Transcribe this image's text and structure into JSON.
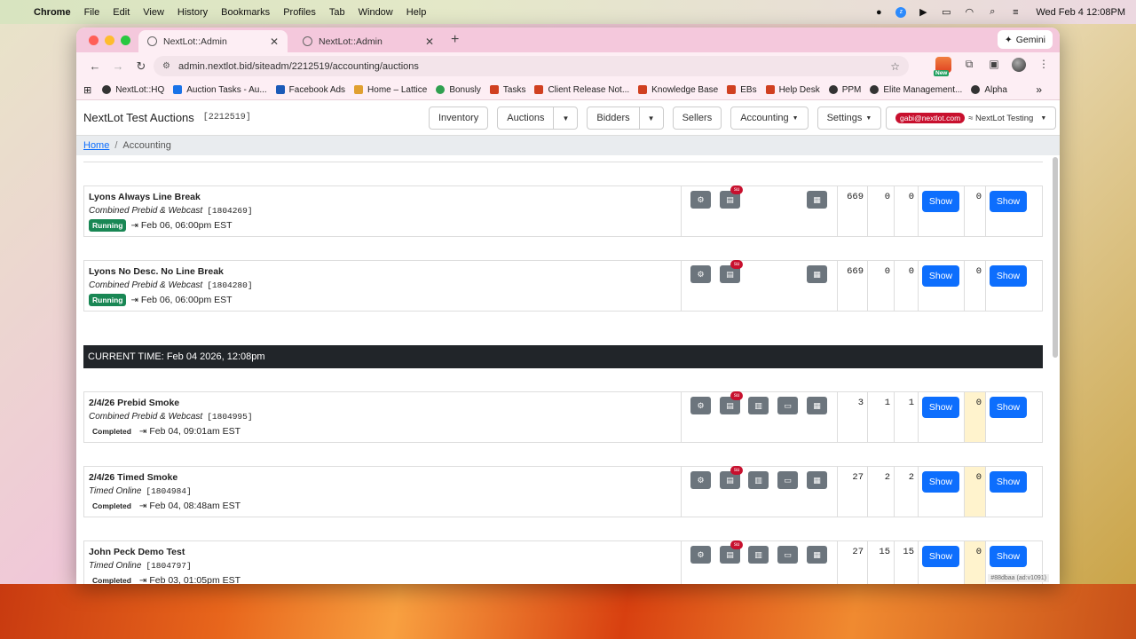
{
  "menubar": {
    "items": [
      "Chrome",
      "File",
      "Edit",
      "View",
      "History",
      "Bookmarks",
      "Profiles",
      "Tab",
      "Window",
      "Help"
    ],
    "clock": "Wed Feb 4  12:08PM"
  },
  "browser": {
    "tabs": [
      {
        "title": "NextLot::Admin"
      },
      {
        "title": "NextLot::Admin"
      }
    ],
    "gemini": "Gemini",
    "url": "admin.nextlot.bid/siteadm/2212519/accounting/auctions",
    "ext_new": "New",
    "bookmarks": [
      {
        "label": "NextLot::HQ",
        "color": "#333"
      },
      {
        "label": "Auction Tasks - Au...",
        "color": "#1a73e8"
      },
      {
        "label": "Facebook Ads",
        "color": "#1a5ab8"
      },
      {
        "label": "Home – Lattice",
        "color": "#e0a030"
      },
      {
        "label": "Bonusly",
        "color": "#30a050"
      },
      {
        "label": "Tasks",
        "color": "#d04020"
      },
      {
        "label": "Client Release Not...",
        "color": "#d04020"
      },
      {
        "label": "Knowledge Base",
        "color": "#d04020"
      },
      {
        "label": "EBs",
        "color": "#d04020"
      },
      {
        "label": "Help Desk",
        "color": "#d04020"
      },
      {
        "label": "PPM",
        "color": "#333"
      },
      {
        "label": "Elite Management...",
        "color": "#333"
      },
      {
        "label": "Alpha",
        "color": "#333"
      }
    ]
  },
  "app": {
    "brand": "NextLot Test Auctions",
    "brand_id": "[2212519]",
    "nav": {
      "inventory": "Inventory",
      "auctions": "Auctions",
      "bidders": "Bidders",
      "sellers": "Sellers",
      "accounting": "Accounting",
      "settings": "Settings"
    },
    "user_email": "gabi@nextlot.com",
    "user_org": "≈ NextLot Testing",
    "breadcrumb": {
      "home": "Home",
      "current": "Accounting"
    },
    "current_time": "CURRENT TIME: Feb 04 2026, 12:08pm",
    "footer_tag": "#88dbaa (ad:v1091)"
  },
  "rows": [
    {
      "title": "Lyons Always Line Break",
      "type": "Combined Prebid & Webcast",
      "code": "[1804269]",
      "status": "Running",
      "date": "Feb 06, 06:00pm EST",
      "c1": "669",
      "c2": "0",
      "c3": "0",
      "show1": "Show",
      "c4": "0",
      "show2": "Show"
    },
    {
      "title": "Lyons No Desc. No Line Break",
      "type": "Combined Prebid & Webcast",
      "code": "[1804280]",
      "status": "Running",
      "date": "Feb 06, 06:00pm EST",
      "c1": "669",
      "c2": "0",
      "c3": "0",
      "show1": "Show",
      "c4": "0",
      "show2": "Show"
    },
    {
      "title": "2/4/26 Prebid Smoke",
      "type": "Combined Prebid & Webcast",
      "code": "[1804995]",
      "status": "Completed",
      "date": "Feb 04, 09:01am EST",
      "c1": "3",
      "c2": "1",
      "c3": "1",
      "show1": "Show",
      "c4": "0",
      "show2": "Show"
    },
    {
      "title": "2/4/26 Timed Smoke",
      "type": "Timed Online",
      "code": "[1804984]",
      "status": "Completed",
      "date": "Feb 04, 08:48am EST",
      "c1": "27",
      "c2": "2",
      "c3": "2",
      "show1": "Show",
      "c4": "0",
      "show2": "Show"
    },
    {
      "title": "John Peck Demo Test",
      "type": "Timed Online",
      "code": "[1804797]",
      "status": "Completed",
      "date": "Feb 03, 01:05pm EST",
      "c1": "27",
      "c2": "15",
      "c3": "15",
      "show1": "Show",
      "c4": "0",
      "show2": "Show"
    }
  ],
  "su_label": "su"
}
